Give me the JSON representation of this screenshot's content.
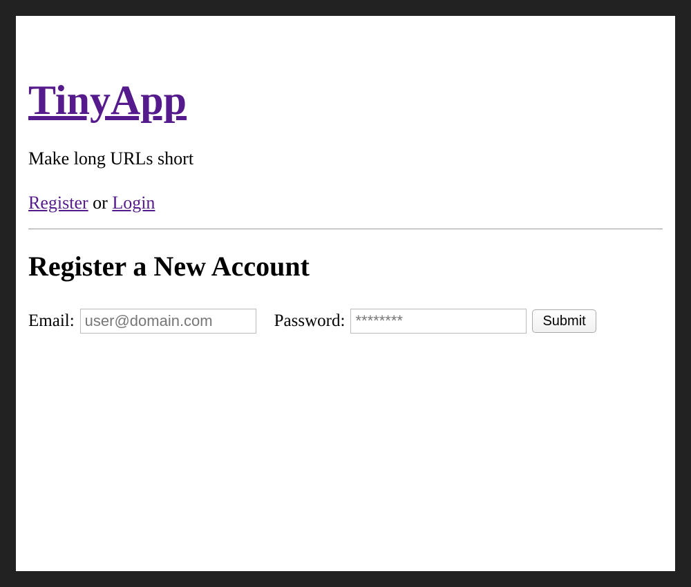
{
  "header": {
    "title": "TinyApp",
    "tagline": "Make long URLs short",
    "register_link": "Register",
    "or_text": " or ",
    "login_link": "Login"
  },
  "section": {
    "heading": "Register a New Account"
  },
  "form": {
    "email_label": "Email:",
    "email_placeholder": "user@domain.com",
    "password_label": "Password:",
    "password_placeholder": "********",
    "submit_label": "Submit"
  }
}
